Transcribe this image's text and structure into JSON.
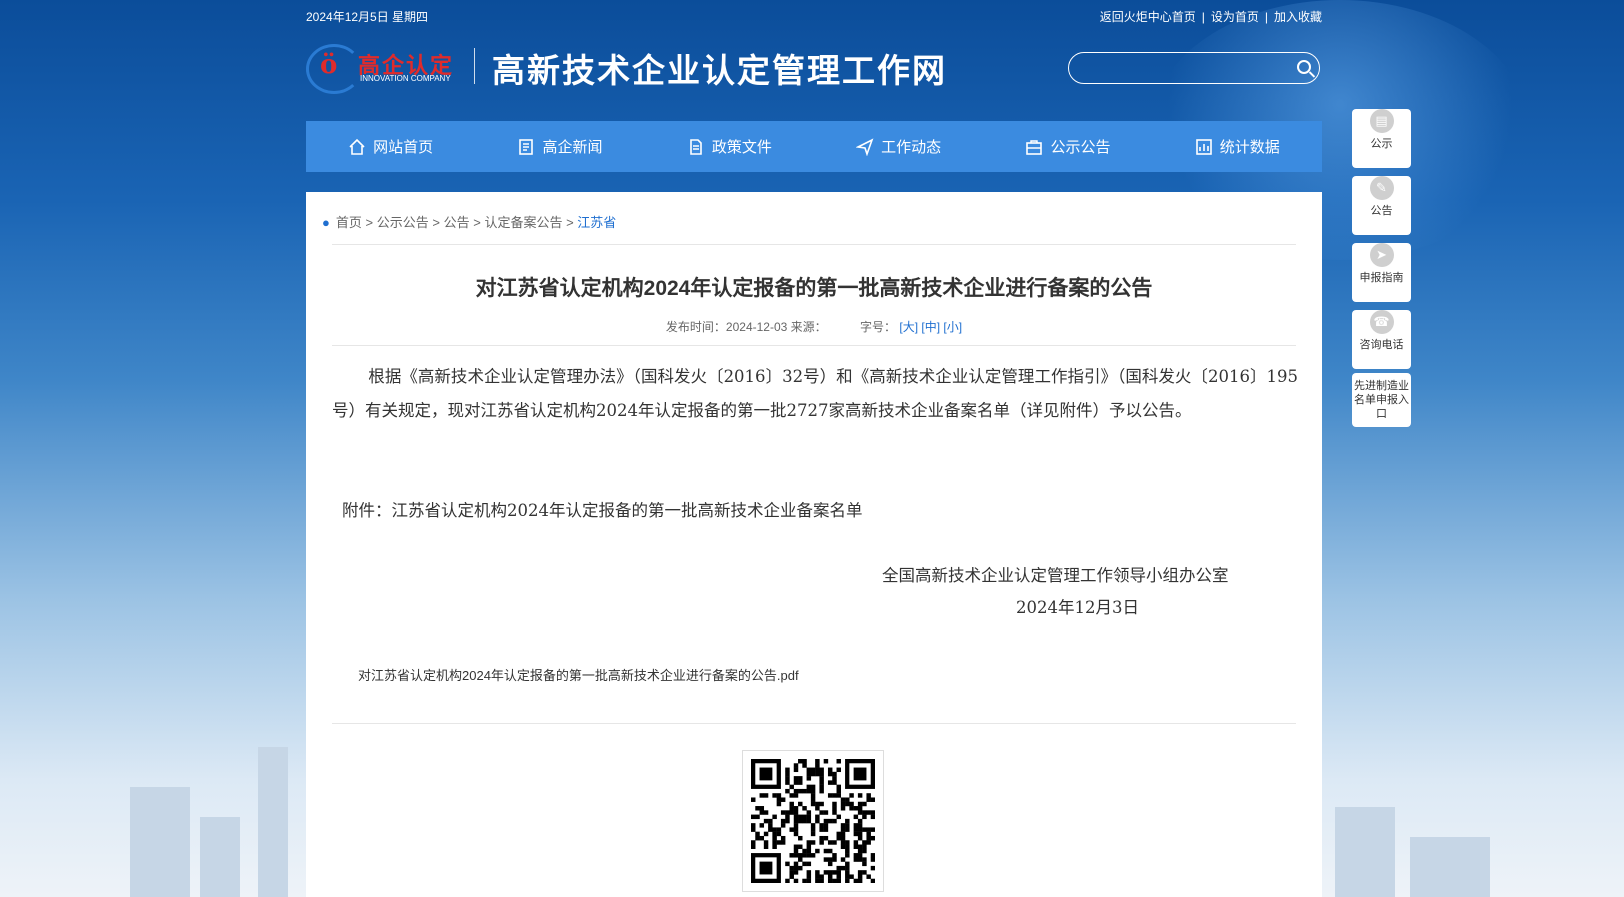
{
  "topbar": {
    "date": "2024年12月5日 星期四",
    "links": [
      "返回火炬中心首页",
      "设为首页",
      "加入收藏"
    ],
    "separator": "|"
  },
  "header": {
    "logo_cn": "高企认定",
    "logo_en": "INNOVATION COMPANY",
    "site_title": "高新技术企业认定管理工作网",
    "search_placeholder": ""
  },
  "nav": [
    {
      "label": "网站首页",
      "icon": "home-icon"
    },
    {
      "label": "高企新闻",
      "icon": "news-icon"
    },
    {
      "label": "政策文件",
      "icon": "document-icon"
    },
    {
      "label": "工作动态",
      "icon": "send-icon"
    },
    {
      "label": "公示公告",
      "icon": "briefcase-icon"
    },
    {
      "label": "统计数据",
      "icon": "chart-icon"
    }
  ],
  "breadcrumb": {
    "items": [
      "首页",
      "公示公告",
      "公告",
      "认定备案公告"
    ],
    "current": "江苏省",
    "sep": ">"
  },
  "article": {
    "title": "对江苏省认定机构2024年认定报备的第一批高新技术企业进行备案的公告",
    "publish_label": "发布时间：",
    "publish_date": "2024-12-03",
    "source_label": "来源：",
    "font_label": "字号：",
    "font_large": "[大]",
    "font_medium": "[中]",
    "font_small": "[小]",
    "paragraph": "根据《高新技术企业认定管理办法》（国科发火〔2016〕32号）和《高新技术企业认定管理工作指引》（国科发火〔2016〕195号）有关规定，现对江苏省认定机构2024年认定报备的第一批2727家高新技术企业备案名单（详见附件）予以公告。",
    "attachment_text": "附件：江苏省认定机构2024年认定报备的第一批高新技术企业备案名单",
    "signature": "全国高新技术企业认定管理工作领导小组办公室",
    "sign_date": "2024年12月3日",
    "pdf_link": "对江苏省认定机构2024年认定报备的第一批高新技术企业进行备案的公告.pdf"
  },
  "side": [
    {
      "label": "公示",
      "icon": "notice-board-icon"
    },
    {
      "label": "公告",
      "icon": "clipboard-icon"
    },
    {
      "label": "申报指南",
      "icon": "compass-icon"
    },
    {
      "label": "咨询电话",
      "icon": "phone-icon"
    },
    {
      "label": "先进制造业名单申报入口",
      "icon": ""
    }
  ],
  "colors": {
    "nav_bg": "#3b8be0",
    "link": "#1f6fd0",
    "logo_red": "#e02b2b"
  }
}
